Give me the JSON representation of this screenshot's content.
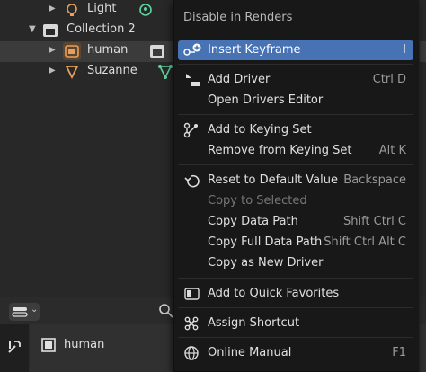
{
  "outliner": {
    "rows": [
      {
        "label": "Light"
      },
      {
        "label": "Collection 2"
      },
      {
        "label": "human"
      },
      {
        "label": "Suzanne"
      }
    ]
  },
  "properties": {
    "object_name": "human"
  },
  "context_menu": {
    "title": "Disable in Renders",
    "items": [
      {
        "label": "Insert Keyframe",
        "shortcut": "I"
      },
      {
        "label": "Add Driver",
        "shortcut": "Ctrl D"
      },
      {
        "label": "Open Drivers Editor",
        "shortcut": ""
      },
      {
        "label": "Add to Keying Set",
        "shortcut": ""
      },
      {
        "label": "Remove from Keying Set",
        "shortcut": "Alt K"
      },
      {
        "label": "Reset to Default Value",
        "shortcut": "Backspace"
      },
      {
        "label": "Copy to Selected",
        "shortcut": ""
      },
      {
        "label": "Copy Data Path",
        "shortcut": "Shift Ctrl C"
      },
      {
        "label": "Copy Full Data Path",
        "shortcut": "Shift Ctrl Alt C"
      },
      {
        "label": "Copy as New Driver",
        "shortcut": ""
      },
      {
        "label": "Add to Quick Favorites",
        "shortcut": ""
      },
      {
        "label": "Assign Shortcut",
        "shortcut": ""
      },
      {
        "label": "Online Manual",
        "shortcut": "F1"
      }
    ]
  },
  "colors": {
    "highlight": "#4772b3",
    "object_orange": "#e8a05a",
    "mesh_green": "#5fd3a0"
  }
}
